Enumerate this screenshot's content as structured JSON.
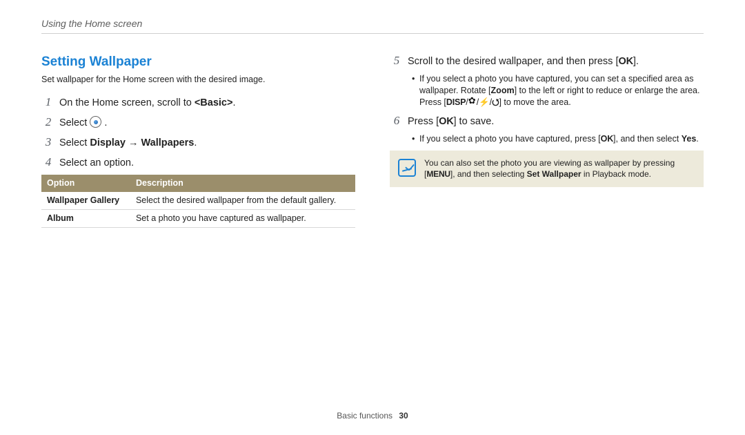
{
  "breadcrumb": "Using the Home screen",
  "section": {
    "title": "Setting Wallpaper",
    "intro": "Set wallpaper for the Home screen with the desired image."
  },
  "left_steps": [
    {
      "n": "1",
      "pre": "On the Home screen, scroll to ",
      "bold": "<Basic>",
      "post": "."
    },
    {
      "n": "2",
      "pre": "Select ",
      "icon": true,
      "post": " ."
    },
    {
      "n": "3",
      "pre": "Select ",
      "bold": "Display",
      "arrow": " → ",
      "bold2": "Wallpapers",
      "post": "."
    },
    {
      "n": "4",
      "pre": "Select an option."
    }
  ],
  "table": {
    "headers": [
      "Option",
      "Description"
    ],
    "rows": [
      [
        "Wallpaper Gallery",
        "Select the desired wallpaper from the default gallery."
      ],
      [
        "Album",
        "Set a photo you have captured as wallpaper."
      ]
    ]
  },
  "right_steps": {
    "five": {
      "n": "5",
      "text_pre": "Scroll to the desired wallpaper, and then press [",
      "ok": "o",
      "text_post": "].",
      "sub": {
        "l1": "If you select a photo you have captured, you can set a specified area as wallpaper. Rotate [",
        "zoom": "Zoom",
        "l2": "] to the left or right to reduce or enlarge the area. Press [",
        "disp": "D",
        "slash": "/",
        "flash": "F",
        "timer": "t",
        "l3": "] to move the area."
      }
    },
    "six": {
      "n": "6",
      "text_pre": "Press [",
      "ok": "o",
      "text_post": "] to save.",
      "sub": {
        "l1": "If you select a photo you have captured, press [",
        "ok": "o",
        "l2": "], and then select ",
        "yes": "Yes",
        "l3": "."
      }
    }
  },
  "note": {
    "pre": "You can also set the photo you are viewing as wallpaper by pressing [",
    "menu": "m",
    "mid": "], and then selecting ",
    "bold": "Set Wallpaper",
    "post": " in Playback mode."
  },
  "footer": {
    "label": "Basic functions",
    "page": "30"
  }
}
